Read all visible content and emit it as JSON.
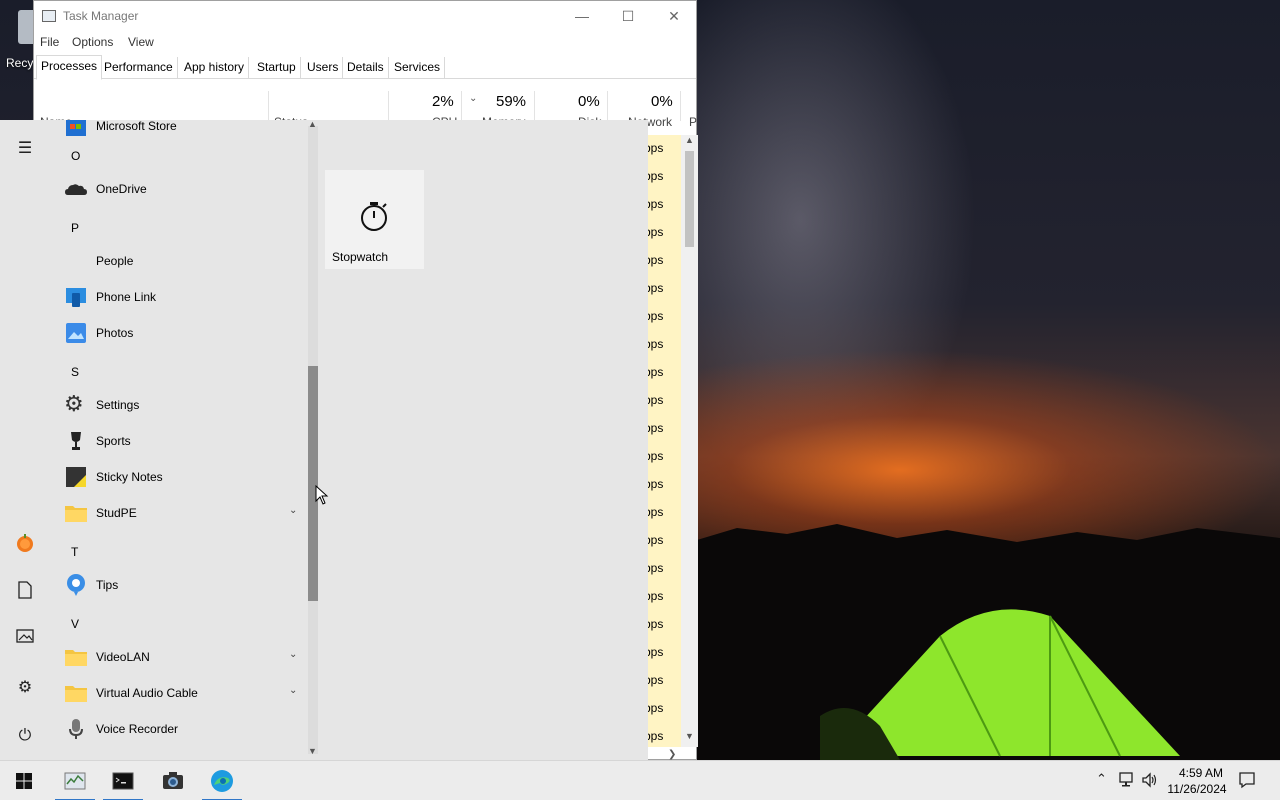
{
  "desktop": {
    "recycle_bin_label": "Recy"
  },
  "task_manager": {
    "title": "Task Manager",
    "menu": [
      "File",
      "Options",
      "View"
    ],
    "tabs": [
      "Processes",
      "Performance",
      "App history",
      "Startup",
      "Users",
      "Details",
      "Services"
    ],
    "active_tab": "Processes",
    "columns": {
      "cpu_pct": "2%",
      "memory_pct": "59%",
      "disk_pct": "0%",
      "network_pct": "0%",
      "cpu_label": "CPU",
      "memory_label": "Memory",
      "disk_label": "Disk",
      "network_label": "Network",
      "name_label": "Name",
      "status_label": "Status",
      "p_label": "P"
    },
    "network_cells": [
      "Mbps",
      "Mbps",
      "Mbps",
      "Mbps",
      "Mbps",
      "Mbps",
      "Mbps",
      "Mbps",
      "Mbps",
      "Mbps",
      "Mbps",
      "Mbps",
      "Mbps",
      "Mbps",
      "Mbps",
      "Mbps",
      "Mbps",
      "Mbps",
      "Mbps",
      "Mbps",
      "Mbps",
      "Mbps"
    ]
  },
  "start_menu": {
    "apps": {
      "microsoft_store": "Microsoft Store",
      "letter_o": "O",
      "onedrive": "OneDrive",
      "letter_p": "P",
      "people": "People",
      "phone_link": "Phone Link",
      "photos": "Photos",
      "letter_s": "S",
      "settings": "Settings",
      "sports": "Sports",
      "sticky_notes": "Sticky Notes",
      "studpe": "StudPE",
      "letter_t": "T",
      "tips": "Tips",
      "letter_v": "V",
      "videolan": "VideoLAN",
      "virtual_audio_cable": "Virtual Audio Cable",
      "voice_recorder": "Voice Recorder"
    },
    "tile": {
      "label": "Stopwatch"
    }
  },
  "taskbar": {
    "time": "4:59 AM",
    "date": "11/26/2024"
  }
}
